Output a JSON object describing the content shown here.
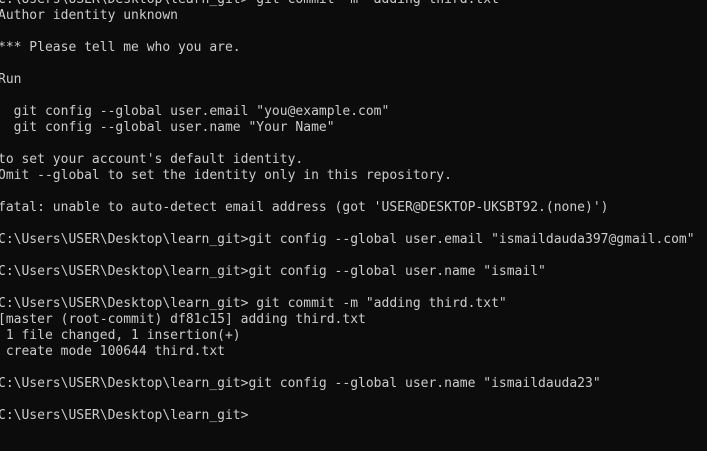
{
  "window": {
    "type": "terminal"
  },
  "terminal": {
    "lines": [
      "C:\\Users\\USER\\Desktop\\learn_git> git commit -m \"adding third.txt\"",
      "Author identity unknown",
      "",
      "*** Please tell me who you are.",
      "",
      "Run",
      "",
      "  git config --global user.email \"you@example.com\"",
      "  git config --global user.name \"Your Name\"",
      "",
      "to set your account's default identity.",
      "Omit --global to set the identity only in this repository.",
      "",
      "fatal: unable to auto-detect email address (got 'USER@DESKTOP-UKSBT92.(none)')",
      "",
      "C:\\Users\\USER\\Desktop\\learn_git>git config --global user.email \"ismaildauda397@gmail.com\"",
      "",
      "C:\\Users\\USER\\Desktop\\learn_git>git config --global user.name \"ismail\"",
      "",
      "C:\\Users\\USER\\Desktop\\learn_git> git commit -m \"adding third.txt\"",
      "[master (root-commit) df81c15] adding third.txt",
      " 1 file changed, 1 insertion(+)",
      " create mode 100644 third.txt",
      "",
      "C:\\Users\\USER\\Desktop\\learn_git>git config --global user.name \"ismaildauda23\"",
      "",
      "C:\\Users\\USER\\Desktop\\learn_git>"
    ]
  },
  "colors": {
    "background": "#0c0c0c",
    "foreground": "#cccccc"
  }
}
